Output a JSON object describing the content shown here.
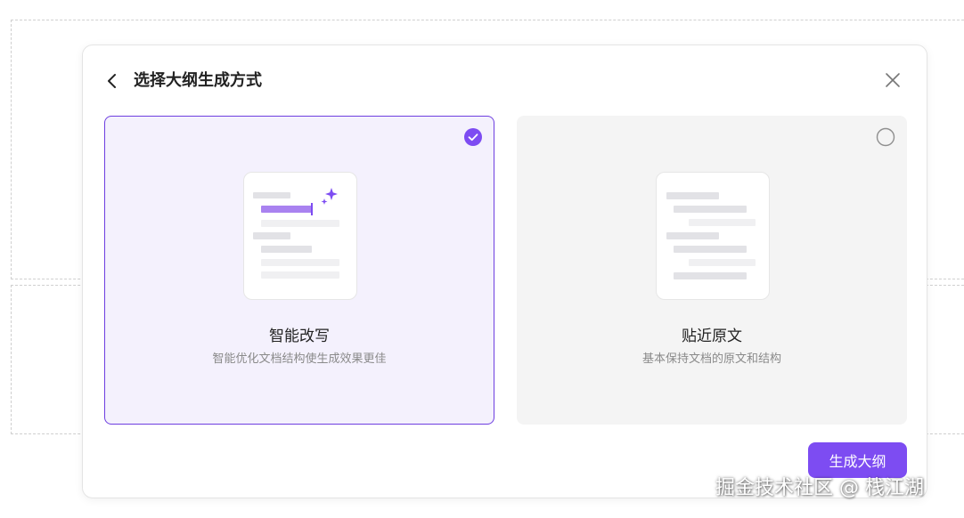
{
  "modal": {
    "title": "选择大纲生成方式",
    "back_icon": "chevron-left-icon",
    "close_icon": "close-icon"
  },
  "options": [
    {
      "title": "智能改写",
      "description": "智能优化文档结构使生成效果更佳",
      "selected": true,
      "illustration": "document-sparkle-icon"
    },
    {
      "title": "贴近原文",
      "description": "基本保持文档的原文和结构",
      "selected": false,
      "illustration": "document-icon"
    }
  ],
  "actions": {
    "generate_label": "生成大纲"
  },
  "watermark": {
    "text": "掘金技术社区 @ 栈江湖"
  },
  "colors": {
    "accent": "#7d4cf2",
    "selected_border": "#6e3ee0",
    "selected_bg": "#f4f1fd",
    "unselected_bg": "#f4f4f4"
  }
}
